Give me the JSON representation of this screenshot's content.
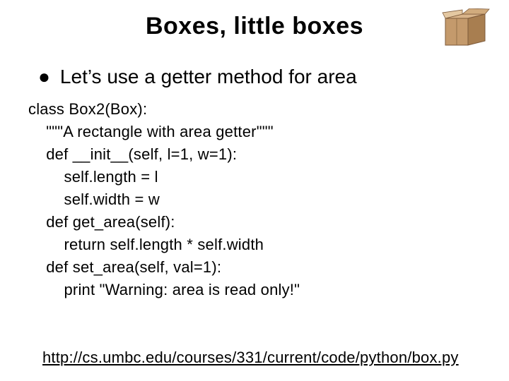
{
  "title": "Boxes, little boxes",
  "bullet": "Let’s use a getter method for area",
  "code": "class Box2(Box):\n    \"\"\"A rectangle with area getter\"\"\"\n    def __init__(self, l=1, w=1):\n        self.length = l\n        self.width = w\n    def get_area(self):\n        return self.length * self.width\n    def set_area(self, val=1):\n        print \"Warning: area is read only!\"",
  "link": "http://cs.umbc.edu/courses/331/current/code/python/box.py"
}
